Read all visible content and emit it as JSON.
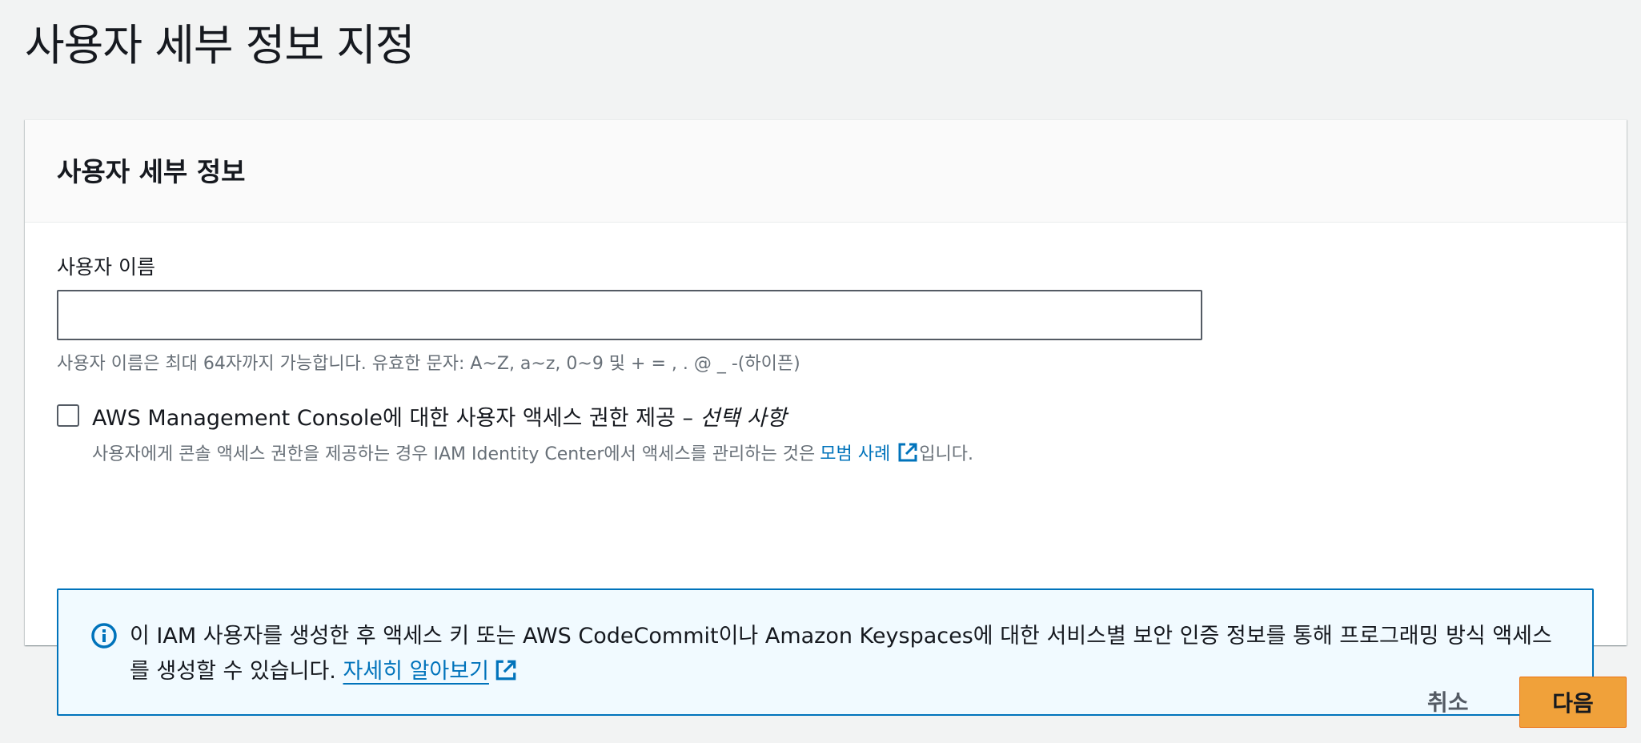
{
  "page": {
    "title": "사용자 세부 정보 지정"
  },
  "card": {
    "title": "사용자 세부 정보",
    "username_label": "사용자 이름",
    "username_value": "",
    "username_constraint": "사용자 이름은 최대 64자까지 가능합니다. 유효한 문자: A~Z, a~z, 0~9 및 + = , . @ _ -(하이픈)",
    "console_access": {
      "checked": false,
      "label": "AWS Management Console에 대한 사용자 액세스 권한 제공 – ",
      "optional": "선택 사항",
      "desc_prefix": "사용자에게 콘솔 액세스 권한을 제공하는 경우 IAM Identity Center에서 액세스를 관리하는 것은",
      "desc_link": "모범 사례",
      "desc_suffix": "입니다."
    },
    "info": {
      "text": "이 IAM 사용자를 생성한 후 액세스 키 또는 AWS CodeCommit이나 Amazon Keyspaces에 대한 서비스별 보안 인증 정보를 통해 프로그래밍 방식 액세스를 생성할 수 있습니다. ",
      "link": "자세히 알아보기"
    }
  },
  "actions": {
    "cancel_label": "취소",
    "next_label": "다음"
  },
  "colors": {
    "link": "#0073bb",
    "primary_button": "#f0a13a",
    "info_border": "#0073bb",
    "info_background": "#f1faff"
  },
  "icons": {
    "info": "info-circle-icon",
    "external": "external-link-icon"
  }
}
